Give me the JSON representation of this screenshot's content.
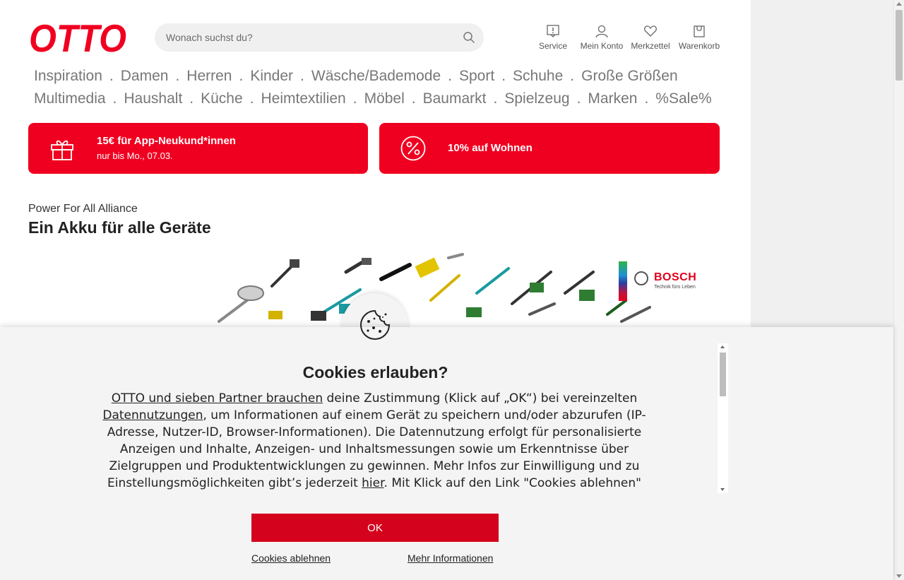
{
  "header": {
    "logo_text": "OTTO",
    "search_placeholder": "Wonach suchst du?",
    "icons": [
      {
        "label": "Service",
        "icon": "service-icon"
      },
      {
        "label": "Mein Konto",
        "icon": "user-icon"
      },
      {
        "label": "Merkzettel",
        "icon": "heart-icon"
      },
      {
        "label": "Warenkorb",
        "icon": "cart-icon"
      }
    ]
  },
  "nav": {
    "row1": [
      "Inspiration",
      "Damen",
      "Herren",
      "Kinder",
      "Wäsche/Bademode",
      "Sport",
      "Schuhe",
      "Große Größen"
    ],
    "row2": [
      "Multimedia",
      "Haushalt",
      "Küche",
      "Heimtextilien",
      "Möbel",
      "Baumarkt",
      "Spielzeug",
      "Marken",
      "%Sale%"
    ],
    "separator": "."
  },
  "promos": [
    {
      "title": "15€ für App-Neukund*innen",
      "subtitle": "nur bis Mo., 07.03.",
      "icon": "gift-icon"
    },
    {
      "title": "10% auf Wohnen",
      "subtitle": "",
      "icon": "percent-icon"
    }
  ],
  "teaser": {
    "kicker": "Power For All Alliance",
    "headline": "Ein Akku für alle Geräte"
  },
  "bosch": {
    "name": "BOSCH",
    "tagline": "Technik fürs Leben"
  },
  "cookie": {
    "title": "Cookies erlauben?",
    "link1": "OTTO und sieben Partner brauchen",
    "text1": " deine Zustimmung (Klick auf „OK“) bei vereinzelten ",
    "link2": "Datennutzungen",
    "text2": ", um Informationen auf einem Gerät zu speichern und/oder abzurufen (IP-Adresse, Nutzer-ID, Browser-Informationen). Die Datennutzung erfolgt für personalisierte Anzeigen und Inhalte, Anzeigen- und Inhaltsmessungen sowie um Erkenntnisse über Zielgruppen und Produktentwicklungen zu gewinnen. Mehr Infos zur Einwilligung und zu Einstellungsmöglichkeiten gibt’s jederzeit ",
    "link3": "hier",
    "text3": ". Mit Klick auf den Link \"Cookies ablehnen\"",
    "ok_label": "OK",
    "reject_label": "Cookies ablehnen",
    "more_label": "Mehr Informationen"
  },
  "colors": {
    "brand_red": "#f00020",
    "button_red": "#d4021d"
  }
}
